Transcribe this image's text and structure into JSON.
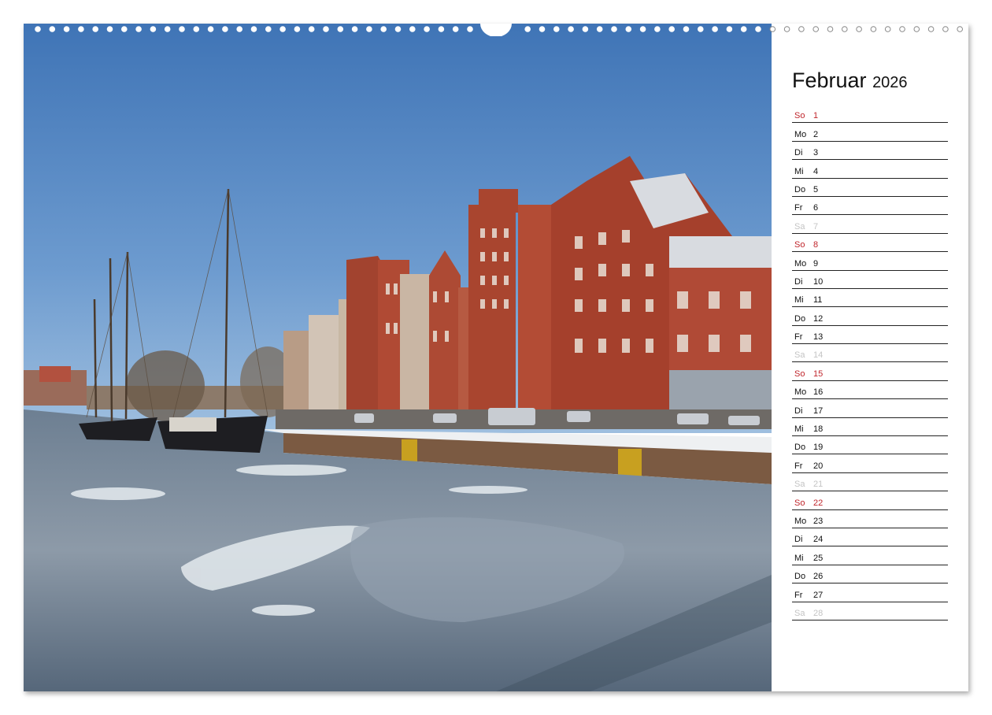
{
  "calendar": {
    "month": "Februar",
    "year": "2026",
    "days": [
      {
        "wd": "So",
        "d": "1",
        "type": "sun"
      },
      {
        "wd": "Mo",
        "d": "2",
        "type": "wk"
      },
      {
        "wd": "Di",
        "d": "3",
        "type": "wk"
      },
      {
        "wd": "Mi",
        "d": "4",
        "type": "wk"
      },
      {
        "wd": "Do",
        "d": "5",
        "type": "wk"
      },
      {
        "wd": "Fr",
        "d": "6",
        "type": "wk"
      },
      {
        "wd": "Sa",
        "d": "7",
        "type": "sat"
      },
      {
        "wd": "So",
        "d": "8",
        "type": "sun"
      },
      {
        "wd": "Mo",
        "d": "9",
        "type": "wk"
      },
      {
        "wd": "Di",
        "d": "10",
        "type": "wk"
      },
      {
        "wd": "Mi",
        "d": "11",
        "type": "wk"
      },
      {
        "wd": "Do",
        "d": "12",
        "type": "wk"
      },
      {
        "wd": "Fr",
        "d": "13",
        "type": "wk"
      },
      {
        "wd": "Sa",
        "d": "14",
        "type": "sat"
      },
      {
        "wd": "So",
        "d": "15",
        "type": "sun"
      },
      {
        "wd": "Mo",
        "d": "16",
        "type": "wk"
      },
      {
        "wd": "Di",
        "d": "17",
        "type": "wk"
      },
      {
        "wd": "Mi",
        "d": "18",
        "type": "wk"
      },
      {
        "wd": "Do",
        "d": "19",
        "type": "wk"
      },
      {
        "wd": "Fr",
        "d": "20",
        "type": "wk"
      },
      {
        "wd": "Sa",
        "d": "21",
        "type": "sat"
      },
      {
        "wd": "So",
        "d": "22",
        "type": "sun"
      },
      {
        "wd": "Mo",
        "d": "23",
        "type": "wk"
      },
      {
        "wd": "Di",
        "d": "24",
        "type": "wk"
      },
      {
        "wd": "Mi",
        "d": "25",
        "type": "wk"
      },
      {
        "wd": "Do",
        "d": "26",
        "type": "wk"
      },
      {
        "wd": "Fr",
        "d": "27",
        "type": "wk"
      },
      {
        "wd": "Sa",
        "d": "28",
        "type": "sat"
      }
    ]
  },
  "colors": {
    "sunday": "#c0262c",
    "saturday": "#c4c4c4",
    "weekday": "#111111",
    "rule": "#222222"
  },
  "photo": {
    "icon": "harbor-photo"
  }
}
